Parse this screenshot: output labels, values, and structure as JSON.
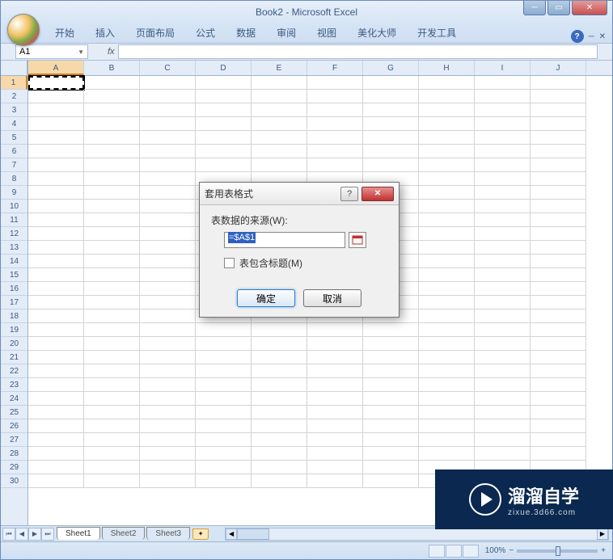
{
  "app": {
    "title": "Book2 - Microsoft Excel"
  },
  "ribbon": {
    "tabs": [
      "开始",
      "插入",
      "页面布局",
      "公式",
      "数据",
      "审阅",
      "视图",
      "美化大师",
      "开发工具"
    ]
  },
  "namebox": {
    "value": "A1",
    "fx": "fx"
  },
  "columns": [
    "A",
    "B",
    "C",
    "D",
    "E",
    "F",
    "G",
    "H",
    "I",
    "J"
  ],
  "rows": [
    "1",
    "2",
    "3",
    "4",
    "5",
    "6",
    "7",
    "8",
    "9",
    "10",
    "11",
    "12",
    "13",
    "14",
    "15",
    "16",
    "17",
    "18",
    "19",
    "20",
    "21",
    "22",
    "23",
    "24",
    "25",
    "26",
    "27",
    "28",
    "29",
    "30"
  ],
  "sheets": {
    "items": [
      "Sheet1",
      "Sheet2",
      "Sheet3"
    ]
  },
  "statusbar": {
    "zoom": "100%",
    "minus": "−",
    "plus": "+"
  },
  "dialog": {
    "title": "套用表格式",
    "source_label": "表数据的来源(W):",
    "source_value": "=$A$1",
    "headers_label": "表包含标题(M)",
    "ok": "确定",
    "cancel": "取消",
    "help": "?",
    "close": "✕"
  },
  "watermark": {
    "text": "溜溜自学",
    "sub": "zixue.3d66.com"
  }
}
